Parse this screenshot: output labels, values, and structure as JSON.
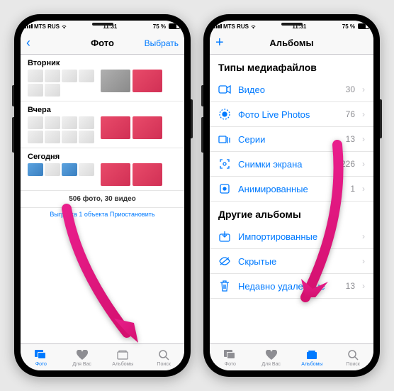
{
  "status": {
    "carrier": "MTS RUS",
    "time": "11:31",
    "battery": "75 %"
  },
  "left": {
    "nav": {
      "title": "Фото",
      "right": "Выбрать"
    },
    "sections": [
      "Вторник",
      "Вчера",
      "Сегодня"
    ],
    "summary": "506 фото, 30 видео",
    "upload_prefix": "Выгрузка 1 объекта ",
    "upload_action": "Приостановить",
    "tabs": [
      "Фото",
      "Для Вас",
      "Альбомы",
      "Поиск"
    ]
  },
  "right": {
    "nav": {
      "title": "Альбомы"
    },
    "sec1": {
      "title": "Типы медиафайлов",
      "rows": [
        {
          "label": "Видео",
          "count": "30"
        },
        {
          "label": "Фото Live Photos",
          "count": "76"
        },
        {
          "label": "Серии",
          "count": "13"
        },
        {
          "label": "Снимки экрана",
          "count": "226"
        },
        {
          "label": "Анимированные",
          "count": "1"
        }
      ]
    },
    "sec2": {
      "title": "Другие альбомы",
      "rows": [
        {
          "label": "Импортированные"
        },
        {
          "label": "Скрытые"
        },
        {
          "label": "Недавно удаленные",
          "count": "13"
        }
      ]
    },
    "tabs": [
      "Фото",
      "Для Вас",
      "Альбомы",
      "Поиск"
    ]
  }
}
